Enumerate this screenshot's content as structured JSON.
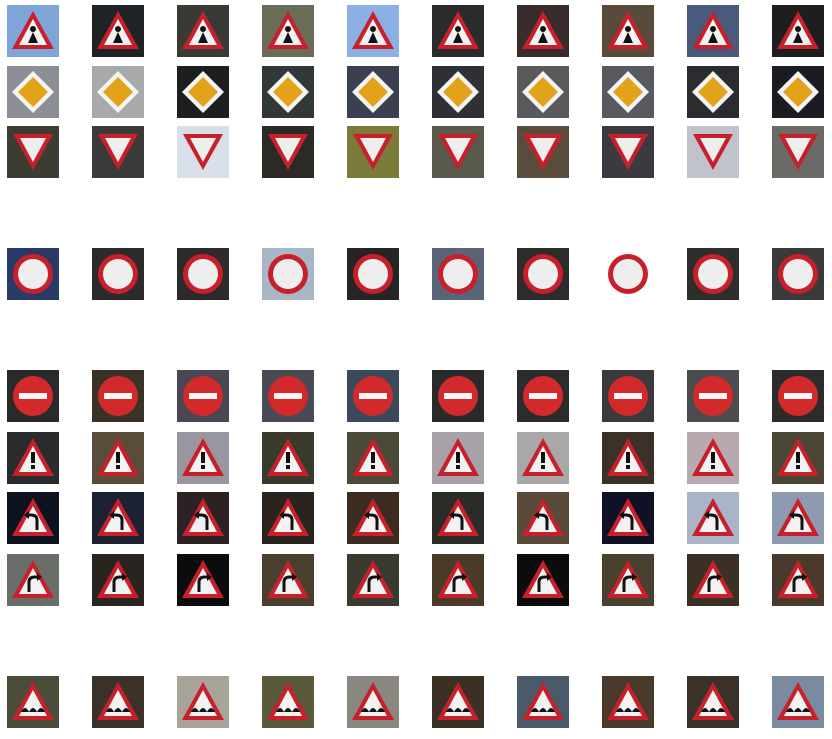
{
  "rows": [
    {
      "sign": "children-crossing",
      "bgs": [
        "#7fa4d8",
        "#202326",
        "#3a3a34",
        "#6b6c58",
        "#8ab0e4",
        "#2a2b2c",
        "#3a2c2c",
        "#5a4a3c",
        "#4a5a7a",
        "#1e1e1e"
      ]
    },
    {
      "sign": "priority-road",
      "bgs": [
        "#8b8e94",
        "#a7a9ab",
        "#1d1e20",
        "#323838",
        "#3b4050",
        "#2e3036",
        "#5a5a5c",
        "#585a60",
        "#2a2c30",
        "#1a1c22"
      ]
    },
    {
      "sign": "yield",
      "bgs": [
        "#3b3d32",
        "#3a3a38",
        "#d7dfe8",
        "#2b2a26",
        "#7a7a3a",
        "#5a5a4c",
        "#5a4c3c",
        "#3a3a40",
        "#c0c2cc",
        "#6a6a66"
      ]
    },
    {
      "sign": "empty",
      "bgs": []
    },
    {
      "sign": "no-vehicles",
      "bgs": [
        "#2a3a66",
        "#2b2b2b",
        "#2c2b2a",
        "#a8b6c8",
        "#262424",
        "#5a6478",
        "#2e2c2a",
        "#ffffff",
        "#2e2e2c",
        "#3a3a3a"
      ]
    },
    {
      "sign": "empty",
      "bgs": []
    },
    {
      "sign": "no-entry",
      "bgs": [
        "#2a2a2a",
        "#3a3228",
        "#4a4654",
        "#4a4a56",
        "#3a4a5a",
        "#2a2a2a",
        "#2c2c2c",
        "#3a3a3c",
        "#4c4c4e",
        "#2c2c2c"
      ]
    },
    {
      "sign": "general-caution",
      "bgs": [
        "#2a2b2c",
        "#5a4c3a",
        "#9a96a0",
        "#3a3a2c",
        "#4a4a36",
        "#a8a2a8",
        "#a8a8a8",
        "#3a3228",
        "#b8a8b0",
        "#4a4636"
      ]
    },
    {
      "sign": "curve-left",
      "bgs": [
        "#0d1220",
        "#1c2232",
        "#2c2224",
        "#2a2420",
        "#3c2c20",
        "#2a2c28",
        "#5a4a3a",
        "#0e1224",
        "#aab4c8",
        "#8e9ab0"
      ]
    },
    {
      "sign": "curve-right",
      "bgs": [
        "#6a6e68",
        "#2a2420",
        "#0c0c0c",
        "#4a4030",
        "#3a3a30",
        "#4a3a28",
        "#0c0c0c",
        "#4a4030",
        "#3a3024",
        "#4a3a2c"
      ]
    },
    {
      "sign": "empty",
      "bgs": []
    },
    {
      "sign": "bumpy-road",
      "bgs": [
        "#4c4c3a",
        "#3a3228",
        "#a8a49a",
        "#5a5a3a",
        "#8a8680",
        "#3a3024",
        "#4a5a6a",
        "#4a3a2c",
        "#3a3228",
        "#7a8aa0"
      ]
    }
  ]
}
